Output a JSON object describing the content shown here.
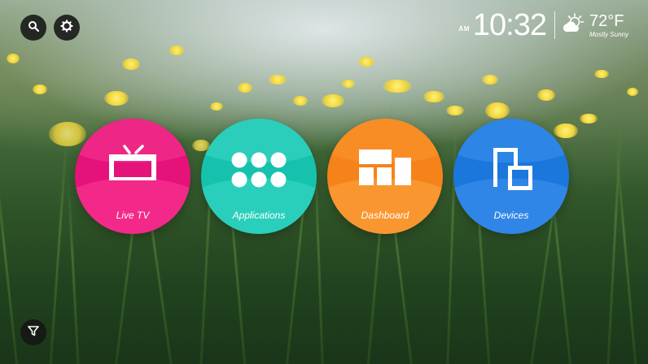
{
  "toolbar": {
    "search_icon": "search-icon",
    "settings_icon": "gear-icon",
    "filter_icon": "filter-icon"
  },
  "status": {
    "ampm": "AM",
    "time": "10:32",
    "temperature": "72°F",
    "condition": "Mostly Sunny",
    "weather_icon": "partly-sunny-icon"
  },
  "tiles": [
    {
      "label": "Live TV",
      "icon": "tv-icon",
      "color": "#ec1a7e"
    },
    {
      "label": "Applications",
      "icon": "apps-grid-icon",
      "color": "#1fc9b4"
    },
    {
      "label": "Dashboard",
      "icon": "dashboard-icon",
      "color": "#f7891e"
    },
    {
      "label": "Devices",
      "icon": "devices-icon",
      "color": "#1e7fdd"
    }
  ]
}
